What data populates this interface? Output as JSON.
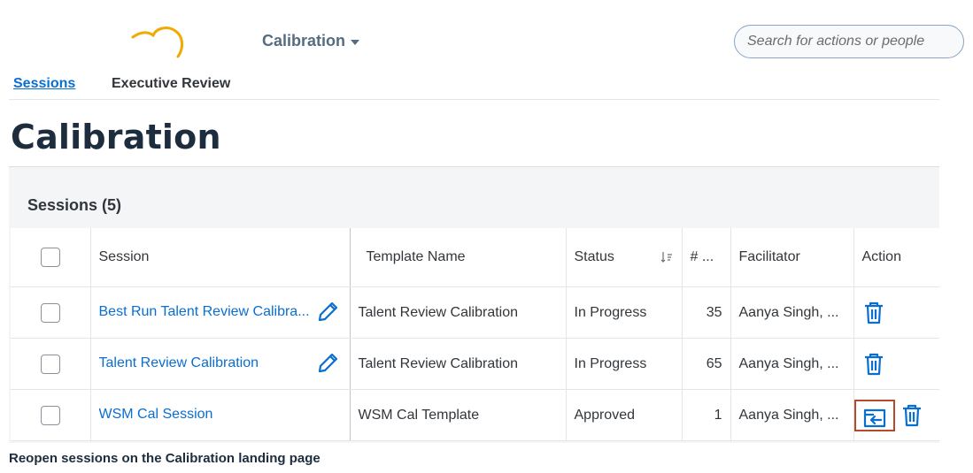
{
  "header": {
    "app_menu_label": "Calibration",
    "search_placeholder": "Search for actions or people",
    "brand_color": "#f0ab00"
  },
  "breadcrumb": {
    "link_label": "Sessions",
    "current_label": "Executive Review"
  },
  "page": {
    "title": "Calibration"
  },
  "sessions": {
    "title": "Sessions (5)",
    "columns": {
      "session": "Session",
      "template": "Template Name",
      "status": "Status",
      "count": "# ...",
      "facilitator": "Facilitator",
      "action": "Action"
    },
    "rows": [
      {
        "session": "Best Run Talent Review Calibra...",
        "template": "Talent Review Calibration",
        "status": "In Progress",
        "count": "35",
        "facilitator": "Aanya Singh, ..."
      },
      {
        "session": "Talent Review Calibration",
        "template": "Talent Review Calibration",
        "status": "In Progress",
        "count": "65",
        "facilitator": "Aanya Singh, ..."
      },
      {
        "session": "WSM Cal Session",
        "template": "WSM Cal Template",
        "status": "Approved",
        "count": "1",
        "facilitator": "Aanya Singh, ..."
      }
    ]
  },
  "caption": "Reopen sessions on the Calibration landing page",
  "icons": [
    "cloud-logo-icon",
    "caret-down-icon",
    "edit-pencil-icon",
    "sort-icon",
    "trash-icon",
    "reopen-icon"
  ],
  "colors": {
    "link": "#0a6ed1",
    "highlight_border": "#b34a2b",
    "title": "#1d2d3e"
  }
}
